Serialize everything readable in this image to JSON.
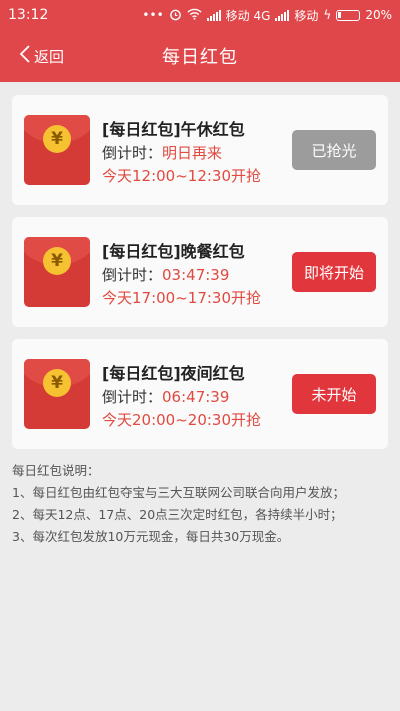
{
  "status_bar": {
    "time": "13:12",
    "carrier1": "移动 4G",
    "carrier2": "移动",
    "battery": "20%",
    "icons": [
      "dots-icon",
      "alarm-icon",
      "wifi-icon",
      "signal-icon",
      "signal-icon",
      "charging-icon",
      "battery-icon"
    ]
  },
  "nav": {
    "back_label": "返回",
    "title": "每日红包"
  },
  "colors": {
    "brand_red": "#e0474a",
    "button_grey": "#9c9c9c",
    "button_red": "#e0363c",
    "highlight_red": "#e04a40",
    "coin_gold": "#f6c231"
  },
  "packets": [
    {
      "title": "[每日红包]午休红包",
      "countdown_label": "倒计时：",
      "countdown_value": "明日再来",
      "window": "今天12:00~12:30开抢",
      "button": "已抢光",
      "button_style": "grey"
    },
    {
      "title": "[每日红包]晚餐红包",
      "countdown_label": "倒计时：",
      "countdown_value": "03:47:39",
      "window": "今天17:00~17:30开抢",
      "button": "即将开始",
      "button_style": "red"
    },
    {
      "title": "[每日红包]夜间红包",
      "countdown_label": "倒计时：",
      "countdown_value": "06:47:39",
      "window": "今天20:00~20:30开抢",
      "button": "未开始",
      "button_style": "red"
    }
  ],
  "coin_symbol": "¥",
  "notes": {
    "heading": "每日红包说明：",
    "lines": [
      "1、每日红包由红包夺宝与三大互联网公司联合向用户发放；",
      "2、每天12点、17点、20点三次定时红包，各持续半小时；",
      "3、每次红包发放10万元现金，每日共30万现金。"
    ]
  }
}
